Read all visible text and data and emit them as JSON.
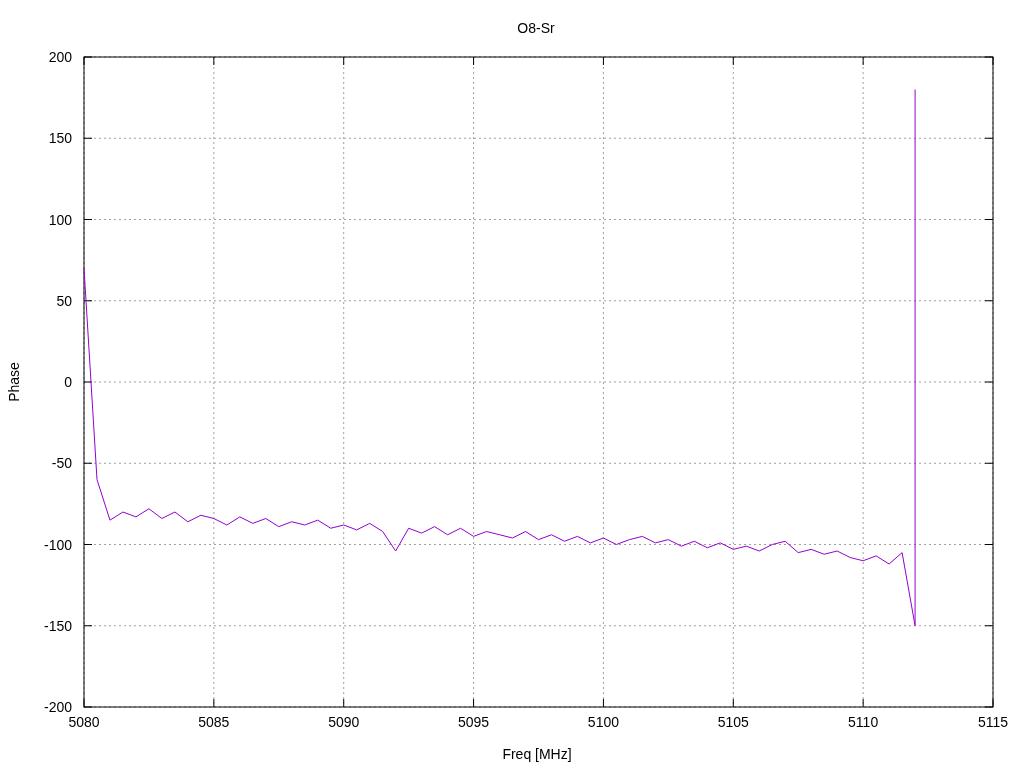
{
  "chart_data": {
    "type": "line",
    "title": "O8-Sr",
    "xlabel": "Freq [MHz]",
    "ylabel": "Phase",
    "x": [
      5080,
      5080.5,
      5081,
      5081.5,
      5082,
      5082.5,
      5083,
      5083.5,
      5084,
      5084.5,
      5085,
      5085.5,
      5086,
      5086.5,
      5087,
      5087.5,
      5088,
      5088.5,
      5089,
      5089.5,
      5090,
      5090.5,
      5091,
      5091.5,
      5092,
      5092.5,
      5093,
      5093.5,
      5094,
      5094.5,
      5095,
      5095.5,
      5096,
      5096.5,
      5097,
      5097.5,
      5098,
      5098.5,
      5099,
      5099.5,
      5100,
      5100.5,
      5101,
      5101.5,
      5102,
      5102.5,
      5103,
      5103.5,
      5104,
      5104.5,
      5105,
      5105.5,
      5106,
      5106.5,
      5107,
      5107.5,
      5108,
      5108.5,
      5109,
      5109.5,
      5110,
      5110.5,
      5111,
      5111.5,
      5112,
      5112
    ],
    "grid": true,
    "series": [
      {
        "color": "#9400d3",
        "values": [
          70,
          -60,
          -85,
          -80,
          -83,
          -78,
          -84,
          -80,
          -86,
          -82,
          -84,
          -88,
          -83,
          -87,
          -84,
          -89,
          -86,
          -88,
          -85,
          -90,
          -88,
          -91,
          -87,
          -92,
          -104,
          -90,
          -93,
          -89,
          -94,
          -90,
          -95,
          -92,
          -94,
          -96,
          -92,
          -97,
          -94,
          -98,
          -95,
          -99,
          -96,
          -100,
          -97,
          -95,
          -99,
          -97,
          -101,
          -98,
          -102,
          -99,
          -103,
          -101,
          -104,
          -100,
          -98,
          -105,
          -103,
          -106,
          -104,
          -108,
          -110,
          -107,
          -112,
          -105,
          -150,
          180
        ]
      }
    ],
    "xlim": [
      5080,
      5115
    ],
    "ylim": [
      -200,
      200
    ],
    "xticks": [
      5080,
      5085,
      5090,
      5095,
      5100,
      5105,
      5110,
      5115
    ],
    "yticks": [
      -200,
      -150,
      -100,
      -50,
      0,
      50,
      100,
      150,
      200
    ]
  }
}
